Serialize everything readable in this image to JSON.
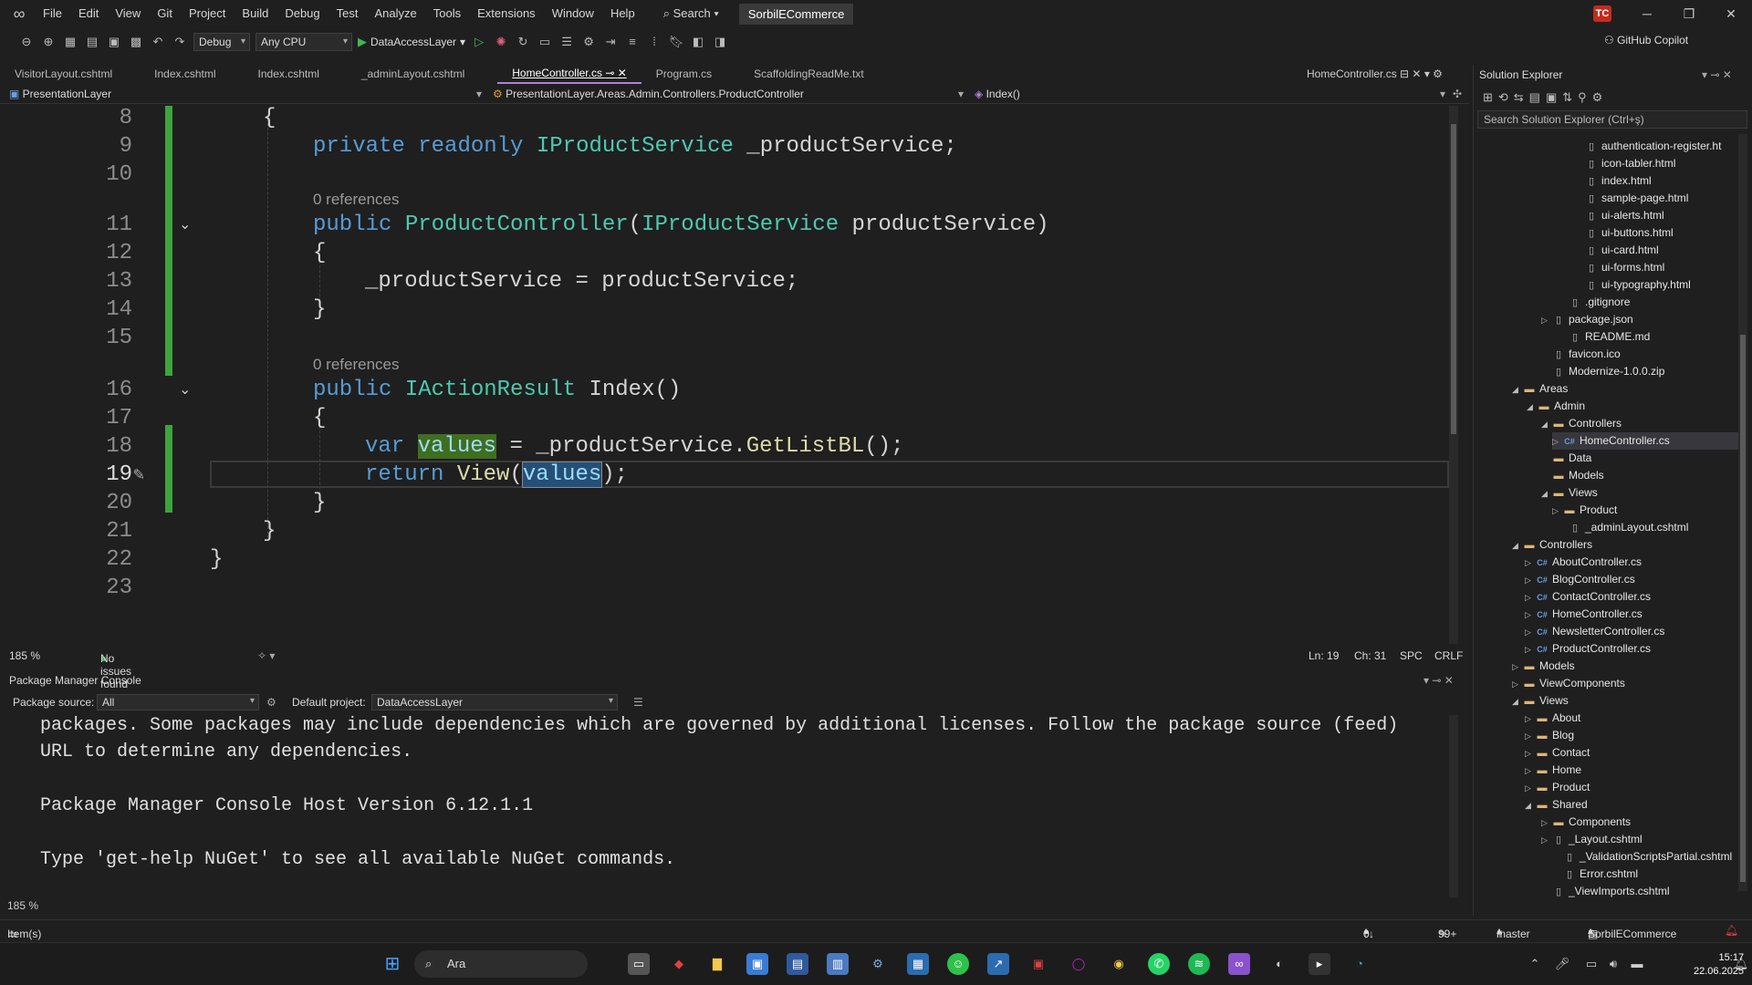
{
  "menubar": {
    "items": [
      "File",
      "Edit",
      "View",
      "Git",
      "Project",
      "Build",
      "Debug",
      "Test",
      "Analyze",
      "Tools",
      "Extensions",
      "Window",
      "Help"
    ],
    "search": "Search",
    "solution": "SorbilECommerce",
    "avatar": "TC"
  },
  "toolbar": {
    "config": "Debug",
    "platform": "Any CPU",
    "startup": "DataAccessLayer",
    "copilot": "GitHub Copilot"
  },
  "tabs": {
    "items": [
      "VisitorLayout.cshtml",
      "Index.cshtml",
      "Index.cshtml",
      "_adminLayout.cshtml",
      "HomeController.cs",
      "Program.cs",
      "ScaffoldingReadMe.txt"
    ],
    "active": "HomeController.cs",
    "right": "HomeController.cs"
  },
  "navbar": {
    "project": "PresentationLayer",
    "type": "PresentationLayer.Areas.Admin.Controllers.ProductController",
    "member": "Index()"
  },
  "editor": {
    "line_numbers": [
      "8",
      "9",
      "10",
      "11",
      "12",
      "13",
      "14",
      "15",
      "16",
      "17",
      "18",
      "19",
      "20",
      "21",
      "22",
      "23"
    ],
    "codelens": "0 references",
    "code": {
      "l8": "{",
      "l9_kw1": "private",
      "l9_kw2": "readonly",
      "l9_type": "IProductService",
      "l9_rest": " _productService;",
      "l11_kw": "public",
      "l11_fn": "ProductController",
      "l11_paren": "(",
      "l11_type": "IProductService",
      "l11_rest": " productService)",
      "l12": "{",
      "l13": "_productService = productService;",
      "l14": "}",
      "l16_kw": "public",
      "l16_type": "IActionResult",
      "l16_rest": " Index()",
      "l17": "{",
      "l18_kw": "var",
      "l18_var": "values",
      "l18_rest": " = _productService.",
      "l18_fn": "GetListBL",
      "l18_end": "();",
      "l19_kw": "return",
      "l19_fn": "View",
      "l19_open": "(",
      "l19_var": "values",
      "l19_end": ");",
      "l20": "}",
      "l21": "}",
      "l22": "}"
    }
  },
  "editor_status": {
    "zoom": "185 %",
    "issues": "No issues found",
    "ln": "Ln: 19",
    "ch": "Ch: 31",
    "spc": "SPC",
    "crlf": "CRLF"
  },
  "pmc": {
    "title": "Package Manager Console",
    "source_label": "Package source:",
    "source_value": "All",
    "project_label": "Default project:",
    "project_value": "DataAccessLayer",
    "lines": [
      "packages. Some packages may include dependencies which are governed by additional licenses. Follow the package source (feed)",
      "URL to determine any dependencies.",
      "",
      "Package Manager Console Host Version 6.12.1.1",
      "",
      "Type 'get-help NuGet' to see all available NuGet commands."
    ],
    "zoom": "185 %"
  },
  "solution_explorer": {
    "title": "Solution Explorer",
    "search_placeholder": "Search Solution Explorer (Ctrl+ş)",
    "rows": [
      {
        "label": "authentication-register.ht",
        "kind": "file",
        "exp": ""
      },
      {
        "label": "icon-tabler.html",
        "kind": "file",
        "exp": ""
      },
      {
        "label": "index.html",
        "kind": "file",
        "exp": ""
      },
      {
        "label": "sample-page.html",
        "kind": "file",
        "exp": ""
      },
      {
        "label": "ui-alerts.html",
        "kind": "file",
        "exp": ""
      },
      {
        "label": "ui-buttons.html",
        "kind": "file",
        "exp": ""
      },
      {
        "label": "ui-card.html",
        "kind": "file",
        "exp": ""
      },
      {
        "label": "ui-forms.html",
        "kind": "file",
        "exp": ""
      },
      {
        "label": "ui-typography.html",
        "kind": "file",
        "exp": ""
      },
      {
        "label": ".gitignore",
        "kind": "file",
        "exp": ""
      },
      {
        "label": "package.json",
        "kind": "file",
        "exp": "▷"
      },
      {
        "label": "README.md",
        "kind": "file",
        "exp": ""
      },
      {
        "label": "favicon.ico",
        "kind": "file",
        "exp": ""
      },
      {
        "label": "Modernize-1.0.0.zip",
        "kind": "file",
        "exp": ""
      },
      {
        "label": "Areas",
        "kind": "folder",
        "exp": "◢"
      },
      {
        "label": "Admin",
        "kind": "folder",
        "exp": "◢"
      },
      {
        "label": "Controllers",
        "kind": "folder",
        "exp": "◢"
      },
      {
        "label": "HomeController.cs",
        "kind": "cs",
        "exp": "▷"
      },
      {
        "label": "Data",
        "kind": "folder",
        "exp": ""
      },
      {
        "label": "Models",
        "kind": "folder",
        "exp": ""
      },
      {
        "label": "Views",
        "kind": "folder",
        "exp": "◢"
      },
      {
        "label": "Product",
        "kind": "folder",
        "exp": "▷"
      },
      {
        "label": "_adminLayout.cshtml",
        "kind": "file",
        "exp": ""
      },
      {
        "label": "Controllers",
        "kind": "folder",
        "exp": "◢"
      },
      {
        "label": "AboutController.cs",
        "kind": "cs",
        "exp": "▷"
      },
      {
        "label": "BlogController.cs",
        "kind": "cs",
        "exp": "▷"
      },
      {
        "label": "ContactController.cs",
        "kind": "cs",
        "exp": "▷"
      },
      {
        "label": "HomeController.cs",
        "kind": "cs",
        "exp": "▷"
      },
      {
        "label": "NewsletterController.cs",
        "kind": "cs",
        "exp": "▷"
      },
      {
        "label": "ProductController.cs",
        "kind": "cs",
        "exp": "▷"
      },
      {
        "label": "Models",
        "kind": "folder",
        "exp": "▷"
      },
      {
        "label": "ViewComponents",
        "kind": "folder",
        "exp": "▷"
      },
      {
        "label": "Views",
        "kind": "folder",
        "exp": "◢"
      },
      {
        "label": "About",
        "kind": "folder",
        "exp": "▷"
      },
      {
        "label": "Blog",
        "kind": "folder",
        "exp": "▷"
      },
      {
        "label": "Contact",
        "kind": "folder",
        "exp": "▷"
      },
      {
        "label": "Home",
        "kind": "folder",
        "exp": "▷"
      },
      {
        "label": "Product",
        "kind": "folder",
        "exp": "▷"
      },
      {
        "label": "Shared",
        "kind": "folder",
        "exp": "◢"
      },
      {
        "label": "Components",
        "kind": "folder",
        "exp": "▷"
      },
      {
        "label": "_Layout.cshtml",
        "kind": "file",
        "exp": "▷"
      },
      {
        "label": "_ValidationScriptsPartial.cshtml",
        "kind": "file",
        "exp": ""
      },
      {
        "label": "Error.cshtml",
        "kind": "file",
        "exp": ""
      },
      {
        "label": "_ViewImports.cshtml",
        "kind": "file",
        "exp": ""
      }
    ]
  },
  "statusbar": {
    "left": "Item(s) Saved",
    "errors": "0 / 0",
    "changes": "99+",
    "branch": "master",
    "repo": "SorbilECommerce"
  },
  "taskbar": {
    "search": "Ara",
    "time": "15:17",
    "date": "22.06.2025"
  },
  "colors": {
    "accent": "#b180d7",
    "gutter_change": "#3fa33f",
    "keyword": "#569cd6",
    "type": "#4ec9b0",
    "method": "#dcdcaa"
  }
}
